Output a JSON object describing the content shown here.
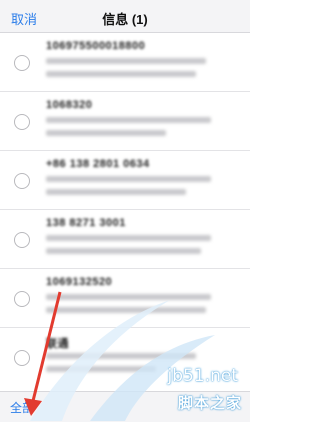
{
  "header": {
    "cancel_label": "取消",
    "title": "信息 (1)"
  },
  "messages": [
    {
      "sender": "106975500018800"
    },
    {
      "sender": "1068320"
    },
    {
      "sender": "+86 138 2801 0634"
    },
    {
      "sender": "138 8271 3001"
    },
    {
      "sender": "1069132520"
    },
    {
      "sender": "联通"
    }
  ],
  "bottom_bar": {
    "select_all_label": "全部"
  },
  "watermark": {
    "site": "jb51.net",
    "name": "脚本之家"
  },
  "colors": {
    "accent": "#2b7de9",
    "arrow": "#e23b2f",
    "watermark_glow": "#3b9ad9"
  }
}
